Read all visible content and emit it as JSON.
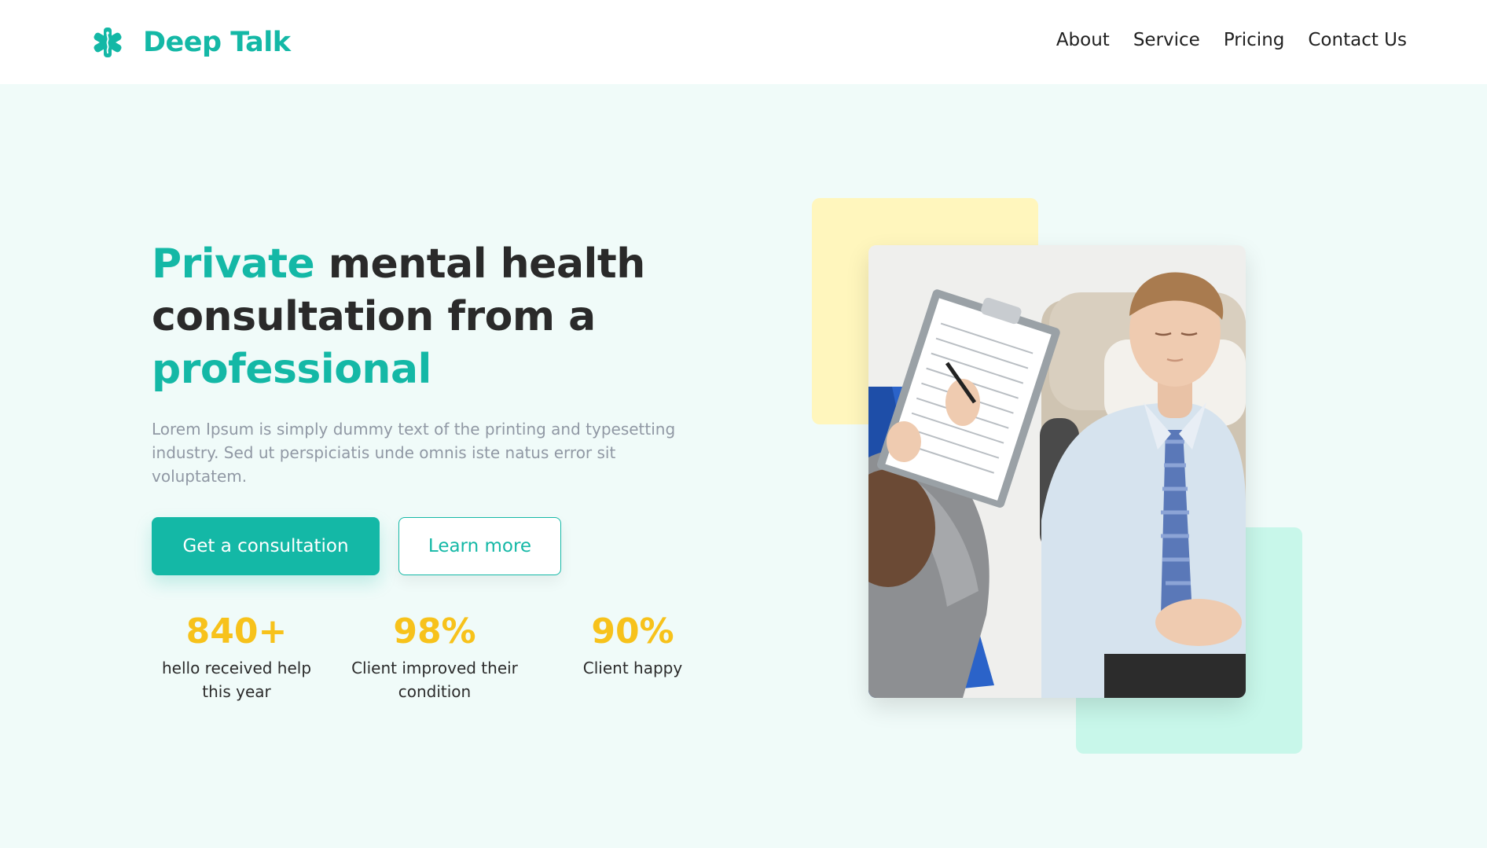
{
  "brand": {
    "name": "Deep Talk",
    "icon": "asterisk-medical-icon",
    "color": "#14b8a6"
  },
  "nav": {
    "items": [
      {
        "label": "About"
      },
      {
        "label": "Service"
      },
      {
        "label": "Pricing"
      },
      {
        "label": "Contact Us"
      }
    ]
  },
  "hero": {
    "headline": {
      "part1": "Private",
      "part2": " mental health consultation from a ",
      "part3": "professional"
    },
    "description": "Lorem Ipsum is simply dummy text of the printing and typesetting industry. Sed ut perspiciatis unde omnis iste natus error sit voluptatem.",
    "primary_button": "Get a consultation",
    "secondary_button": "Learn more",
    "stats": [
      {
        "value": "840+",
        "label": "hello received help this year"
      },
      {
        "value": "98%",
        "label": "Client improved their condition"
      },
      {
        "value": "90%",
        "label": "Client happy"
      }
    ],
    "image": {
      "subject": "therapist-session-photo"
    }
  },
  "colors": {
    "accent": "#14b8a6",
    "stat": "#f7c21b",
    "hero_bg": "#f0fbf9",
    "deco_yellow": "#fff6bd",
    "deco_mint": "#c8f7ea"
  }
}
